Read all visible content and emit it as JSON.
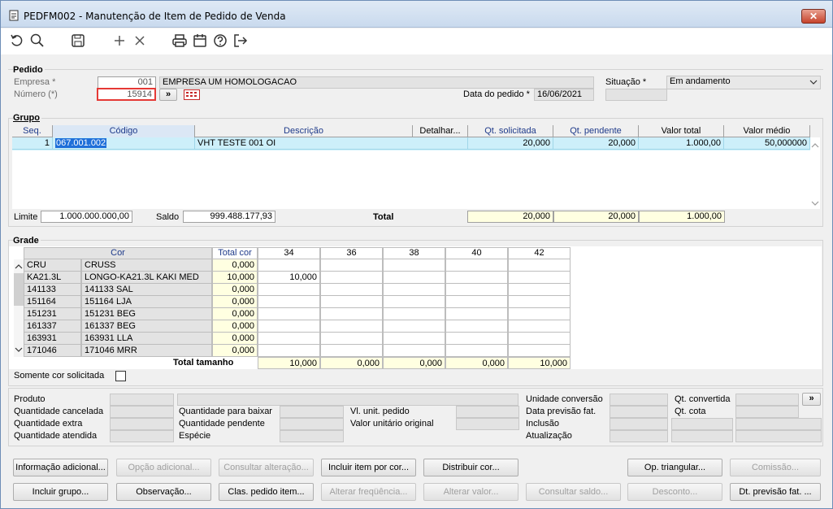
{
  "window": {
    "title": "PEDFM002 - Manutenção de Item de Pedido de Venda",
    "close": "✕"
  },
  "toolbar": {
    "icons": [
      "undo-icon",
      "search-icon",
      "save-icon",
      "add-icon",
      "delete-icon",
      "print-icon",
      "calendar-icon",
      "help-icon",
      "exit-icon"
    ]
  },
  "pedido": {
    "section": "Pedido",
    "empresa_label": "Empresa *",
    "empresa_code": "001",
    "empresa_name": "EMPRESA UM HOMOLOGACAO",
    "numero_label": "Número (*)",
    "numero": "15914",
    "nav_btn": "»",
    "situacao_label": "Situação *",
    "situacao": "Em andamento",
    "data_label": "Data do pedido *",
    "data": "16/06/2021"
  },
  "grupo": {
    "section": "Grupo",
    "headers": [
      "Seq.",
      "Código",
      "Descrição",
      "Detalhar...",
      "Qt. solicitada",
      "Qt. pendente",
      "Valor total",
      "Valor médio"
    ],
    "rows": [
      [
        "1",
        "067.001.002",
        "VHT TESTE 001 OI",
        "",
        "20,000",
        "20,000",
        "1.000,00",
        "50,000000"
      ]
    ],
    "limite_label": "Limite",
    "limite": "1.000.000.000,00",
    "saldo_label": "Saldo",
    "saldo": "999.488.177,93",
    "total_label": "Total",
    "total_qt_sol": "20,000",
    "total_qt_pend": "20,000",
    "total_valor": "1.000,00"
  },
  "grade": {
    "section": "Grade",
    "cor_header": "Cor",
    "totalcor_header": "Total cor",
    "sizes": [
      "34",
      "36",
      "38",
      "40",
      "42"
    ],
    "rows": [
      {
        "code": "CRU",
        "name": "CRUSS",
        "total": "0,000",
        "v": [
          "",
          "",
          "",
          "",
          ""
        ]
      },
      {
        "code": "KA21.3L",
        "name": "LONGO-KA21.3L KAKI MED",
        "total": "10,000",
        "v": [
          "10,000",
          "",
          "",
          "",
          ""
        ]
      },
      {
        "code": "141133",
        "name": "141133 SAL",
        "total": "0,000",
        "v": [
          "",
          "",
          "",
          "",
          ""
        ]
      },
      {
        "code": "151164",
        "name": "151164 LJA",
        "total": "0,000",
        "v": [
          "",
          "",
          "",
          "",
          ""
        ]
      },
      {
        "code": "151231",
        "name": "151231 BEG",
        "total": "0,000",
        "v": [
          "",
          "",
          "",
          "",
          ""
        ]
      },
      {
        "code": "161337",
        "name": "161337 BEG",
        "total": "0,000",
        "v": [
          "",
          "",
          "",
          "",
          ""
        ]
      },
      {
        "code": "163931",
        "name": "163931 LLA",
        "total": "0,000",
        "v": [
          "",
          "",
          "",
          "",
          ""
        ]
      },
      {
        "code": "171046",
        "name": "171046 MRR",
        "total": "0,000",
        "v": [
          "",
          "",
          "",
          "",
          ""
        ]
      }
    ],
    "total_tamanho_label": "Total tamanho",
    "totals": [
      "10,000",
      "0,000",
      "0,000",
      "0,000",
      "10,000"
    ],
    "somente_label": "Somente cor solicitada"
  },
  "info": {
    "produto": "Produto",
    "qt_cancelada": "Quantidade cancelada",
    "qt_extra": "Quantidade extra",
    "qt_atendida": "Quantidade atendida",
    "qt_baixar": "Quantidade para baixar",
    "qt_pendente": "Quantidade pendente",
    "especie": "Espécie",
    "vl_unit": "Vl. unit. pedido",
    "vl_unit_orig": "Valor unitário original",
    "unid_conv": "Unidade conversão",
    "data_prev": "Data previsão fat.",
    "inclusao": "Inclusão",
    "atualizacao": "Atualização",
    "qt_convertida": "Qt. convertida",
    "qt_cota": "Qt. cota",
    "more_btn": "»"
  },
  "buttons": {
    "row1": [
      "Informação adicional...",
      "Opção adicional...",
      "Consultar alteração...",
      "Incluir item por cor...",
      "Distribuir cor...",
      "Op. triangular...",
      "Comissão..."
    ],
    "row2": [
      "Incluir grupo...",
      "Observação...",
      "Clas. pedido item...",
      "Alterar freqüência...",
      "Alterar valor...",
      "Consultar saldo...",
      "Desconto...",
      "Dt. previsão fat. ..."
    ]
  }
}
